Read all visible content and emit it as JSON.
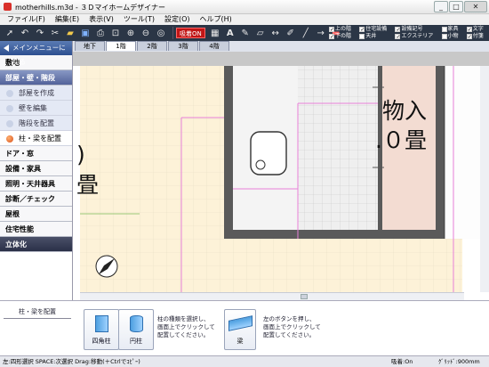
{
  "window": {
    "title": "motherhills.m3d - ３Ｄマイホームデザイナー",
    "buttons": {
      "minimize": "_",
      "maximize": "□",
      "close": "✕"
    }
  },
  "menu": {
    "items": [
      "ファイル(F)",
      "編集(E)",
      "表示(V)",
      "ツール(T)",
      "設定(O)",
      "ヘルプ(H)"
    ]
  },
  "toolbar": {
    "tools": [
      "pointer-icon",
      "undo-icon",
      "redo-icon",
      "scissors-icon",
      "open-icon",
      "save-icon",
      "print-icon",
      "fit-icon",
      "zoom-in-icon",
      "zoom-out-icon",
      "zoom-area-icon"
    ],
    "toggle_label": "吸着ON",
    "draw_tools": [
      "grid-icon",
      "text-icon",
      "paint-icon",
      "eraser-icon",
      "dimension-icon",
      "pencil-icon",
      "line-icon",
      "arrow-icon",
      "wall-icon"
    ]
  },
  "display_checks": [
    {
      "label": "上の階",
      "checked": true
    },
    {
      "label": "住宅設備",
      "checked": true
    },
    {
      "label": "設備記号",
      "checked": true
    },
    {
      "label": "家具",
      "checked": false
    },
    {
      "label": "文字",
      "checked": true
    },
    {
      "label": "下の階",
      "checked": true
    },
    {
      "label": "天井",
      "checked": false
    },
    {
      "label": "エクステリア",
      "checked": true
    },
    {
      "label": "小物",
      "checked": false
    },
    {
      "label": "付箋",
      "checked": true
    }
  ],
  "sidebar": {
    "back_label": "メインメニューに戻る",
    "items": [
      {
        "kind": "cat",
        "label": "敷地"
      },
      {
        "kind": "cat",
        "label": "部屋・壁・階段",
        "active": true
      },
      {
        "kind": "sub",
        "label": "部屋を作成"
      },
      {
        "kind": "sub",
        "label": "壁を編集"
      },
      {
        "kind": "sub",
        "label": "階段を配置"
      },
      {
        "kind": "sub",
        "label": "柱・梁を配置",
        "active": true
      },
      {
        "kind": "cat",
        "label": "ドア・窓"
      },
      {
        "kind": "cat",
        "label": "設備・家具"
      },
      {
        "kind": "cat",
        "label": "照明・天井器具"
      },
      {
        "kind": "cat",
        "label": "診断／チェック"
      },
      {
        "kind": "cat",
        "label": "屋根"
      },
      {
        "kind": "cat",
        "label": "住宅性能"
      },
      {
        "kind": "cat",
        "label": "立体化",
        "dark": true
      }
    ]
  },
  "floor_tabs": [
    "地下",
    "1階",
    "2階",
    "3階",
    "4階"
  ],
  "active_floor_tab": 1,
  "plan": {
    "room_right_line1": "物入",
    "room_right_line2": ".０畳",
    "room_left_fragment": "畳",
    "compass_icon": "compass-icon"
  },
  "bottom_panel": {
    "title": "柱・梁を配置",
    "pillar_square": "四角柱",
    "pillar_round": "円柱",
    "pillar_hint": "柱の種類を選択し、\n画面上でクリックして\n配置してください。",
    "beam": "梁",
    "beam_hint": "左のボタンを押し、\n画面上でクリックして\n配置してください。"
  },
  "status": {
    "left": "左:四形選択 SPACE:次選択 Drag:移動(＋Ctrlでｺﾋﾟｰ)",
    "snap": "吸着:On",
    "grid": "ｸﾞﾘｯﾄﾞ:900mm"
  },
  "colors": {
    "toolbar_bg": "#2b3646",
    "floor_beige": "#fdf2d8",
    "wall_dark": "#5a5a5a",
    "closet_pink": "#f3dcd2",
    "pink_line": "#e880d8",
    "accent_red": "#c21616"
  }
}
